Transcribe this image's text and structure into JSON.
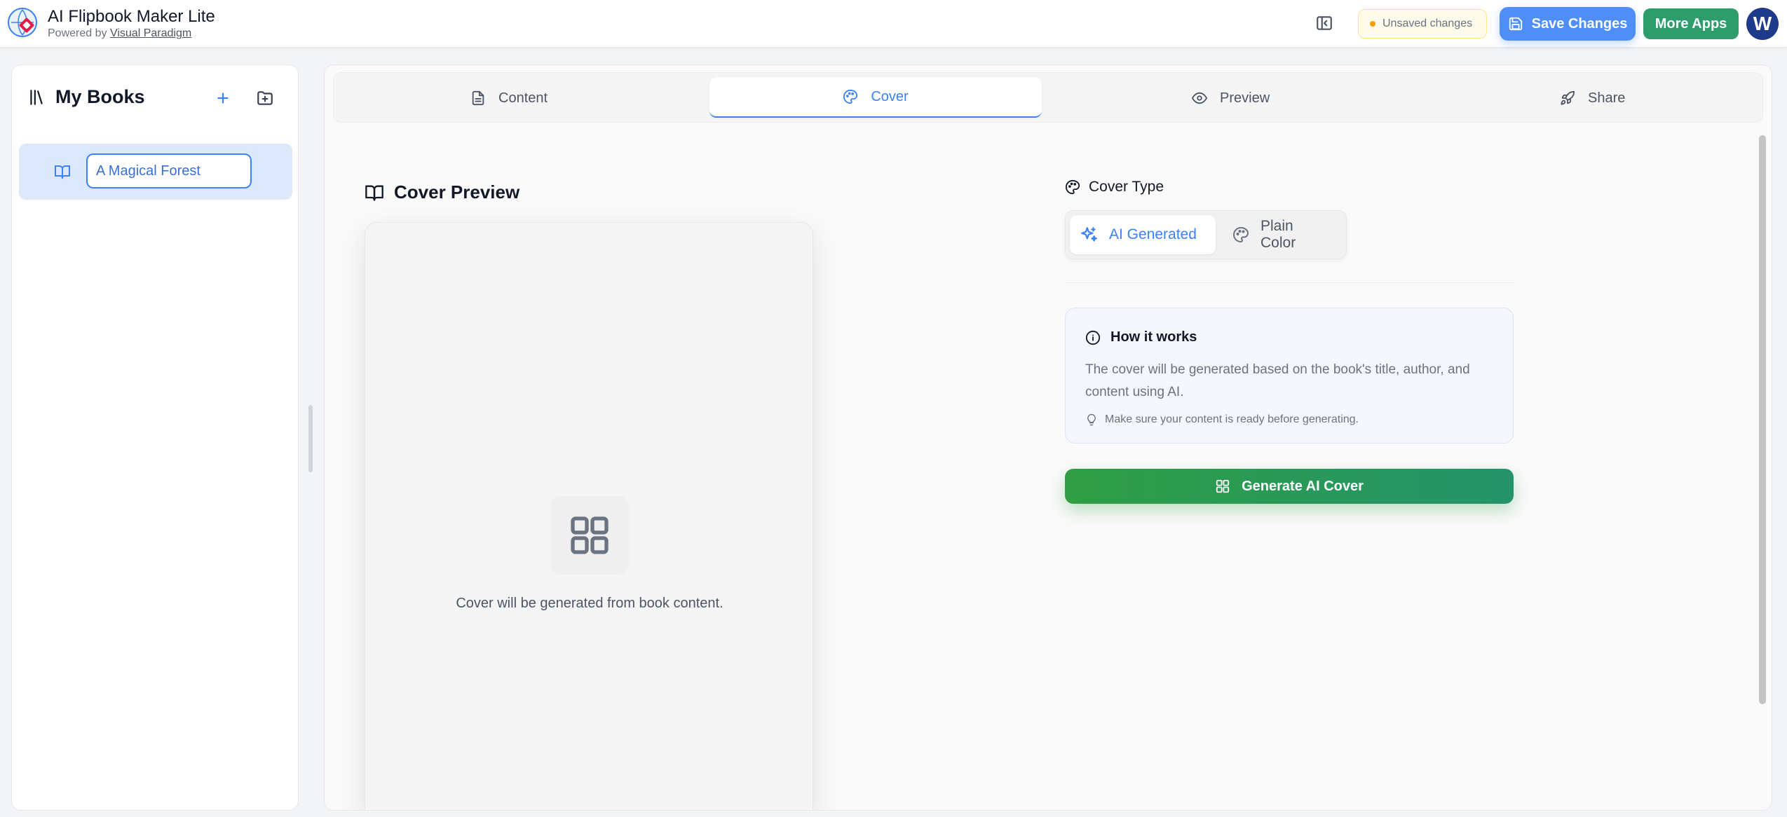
{
  "header": {
    "app_title": "AI Flipbook Maker Lite",
    "powered_by": "Powered by",
    "powered_link": "Visual Paradigm",
    "unsaved": "Unsaved changes",
    "save_label": "Save Changes",
    "more_apps_label": "More Apps",
    "avatar_initial": "W"
  },
  "sidebar": {
    "title": "My Books",
    "books": [
      {
        "title": "A Magical Forest"
      }
    ]
  },
  "tabs": [
    {
      "label": "Content",
      "icon": "document-icon"
    },
    {
      "label": "Cover",
      "icon": "palette-icon",
      "active": true
    },
    {
      "label": "Preview",
      "icon": "eye-icon"
    },
    {
      "label": "Share",
      "icon": "rocket-icon"
    }
  ],
  "cover_preview": {
    "title": "Cover Preview",
    "message": "Cover will be generated from book content."
  },
  "cover_type": {
    "title": "Cover Type",
    "options": [
      {
        "label": "AI Generated",
        "selected": true
      },
      {
        "label": "Plain Color",
        "selected": false
      }
    ]
  },
  "how_it_works": {
    "title": "How it works",
    "body": "The cover will be generated based on the book's title, author, and content using AI.",
    "tip": "Make sure your content is ready before generating."
  },
  "generate_label": "Generate AI Cover",
  "colors": {
    "accent": "#3b82f6",
    "save_button": "#4f8ef7",
    "more_apps": "#2e9d6b",
    "generate": "#2f9e44",
    "avatar": "#1e3a8a",
    "unsaved_dot": "#f59e0b"
  }
}
